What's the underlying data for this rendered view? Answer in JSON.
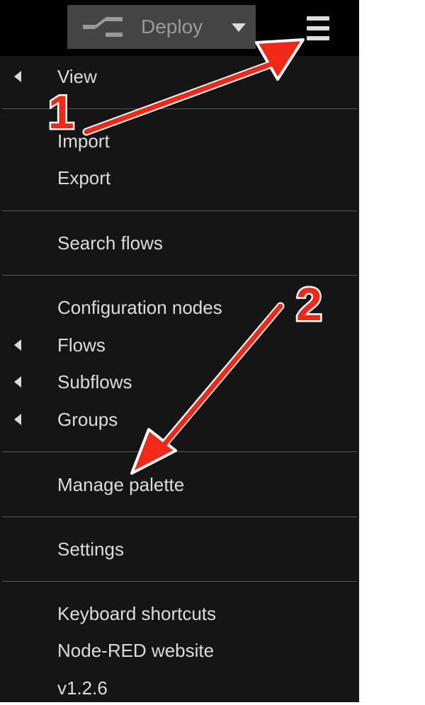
{
  "toolbar": {
    "deploy_label": "Deploy",
    "deploy_icon": "deploy-flow-icon",
    "caret_icon": "caret-down-icon",
    "menu_icon": "hamburger-menu-icon"
  },
  "menu": {
    "items": [
      {
        "label": "View",
        "submenu": true
      },
      {
        "label": "Import",
        "submenu": false
      },
      {
        "label": "Export",
        "submenu": false
      },
      {
        "label": "Search flows",
        "submenu": false
      },
      {
        "label": "Configuration nodes",
        "submenu": false
      },
      {
        "label": "Flows",
        "submenu": true
      },
      {
        "label": "Subflows",
        "submenu": true
      },
      {
        "label": "Groups",
        "submenu": true
      },
      {
        "label": "Manage palette",
        "submenu": false
      },
      {
        "label": "Settings",
        "submenu": false
      },
      {
        "label": "Keyboard shortcuts",
        "submenu": false
      },
      {
        "label": "Node-RED website",
        "submenu": false
      },
      {
        "label": "v1.2.6",
        "submenu": false
      }
    ]
  },
  "annotations": {
    "step1": "1",
    "step2": "2",
    "arrow_color": "#f02818"
  },
  "colors": {
    "menu_bg": "#151515",
    "topbar_bg": "#000000",
    "deploy_bg": "#444444",
    "text": "#dcdcdc"
  }
}
